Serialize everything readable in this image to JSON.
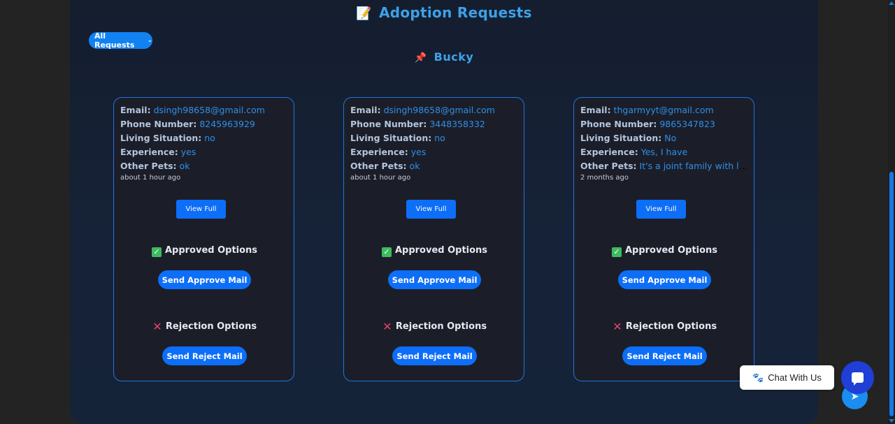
{
  "header": {
    "title_icon": "memo-icon",
    "title": "Adoption Requests"
  },
  "filter": {
    "selected": "All Requests"
  },
  "pet": {
    "icon": "pushpin-icon",
    "name": "Bucky"
  },
  "labels": {
    "email": "Email:",
    "phone": "Phone Number:",
    "living": "Living Situation:",
    "experience": "Experience:",
    "other_pets": "Other Pets:",
    "view_full": "View Full",
    "approved_options": "Approved Options",
    "rejection_options": "Rejection Options",
    "send_approve": "Send Approve Mail",
    "send_reject": "Send Reject Mail"
  },
  "cards": [
    {
      "email": "dsingh98658@gmail.com",
      "phone": "8245963929",
      "living": "no",
      "experience": "yes",
      "other_pets": "ok",
      "time": "about 1 hour ago"
    },
    {
      "email": "dsingh98658@gmail.com",
      "phone": "3448358332",
      "living": "no",
      "experience": "yes",
      "other_pets": "ok",
      "time": "about 1 hour ago"
    },
    {
      "email": "thgarmyyt@gmail.com",
      "phone": "9865347823",
      "living": "No",
      "experience": "Yes, I have",
      "other_pets": "It's a joint family with love...",
      "time": "2 months ago"
    }
  ],
  "chat": {
    "icon": "paw-icon",
    "label": "Chat With Us"
  },
  "colors": {
    "accent": "#3ea1e8",
    "button": "#0d6ef7",
    "card_border": "#1f74e0",
    "value_text": "#2f8fe8"
  }
}
